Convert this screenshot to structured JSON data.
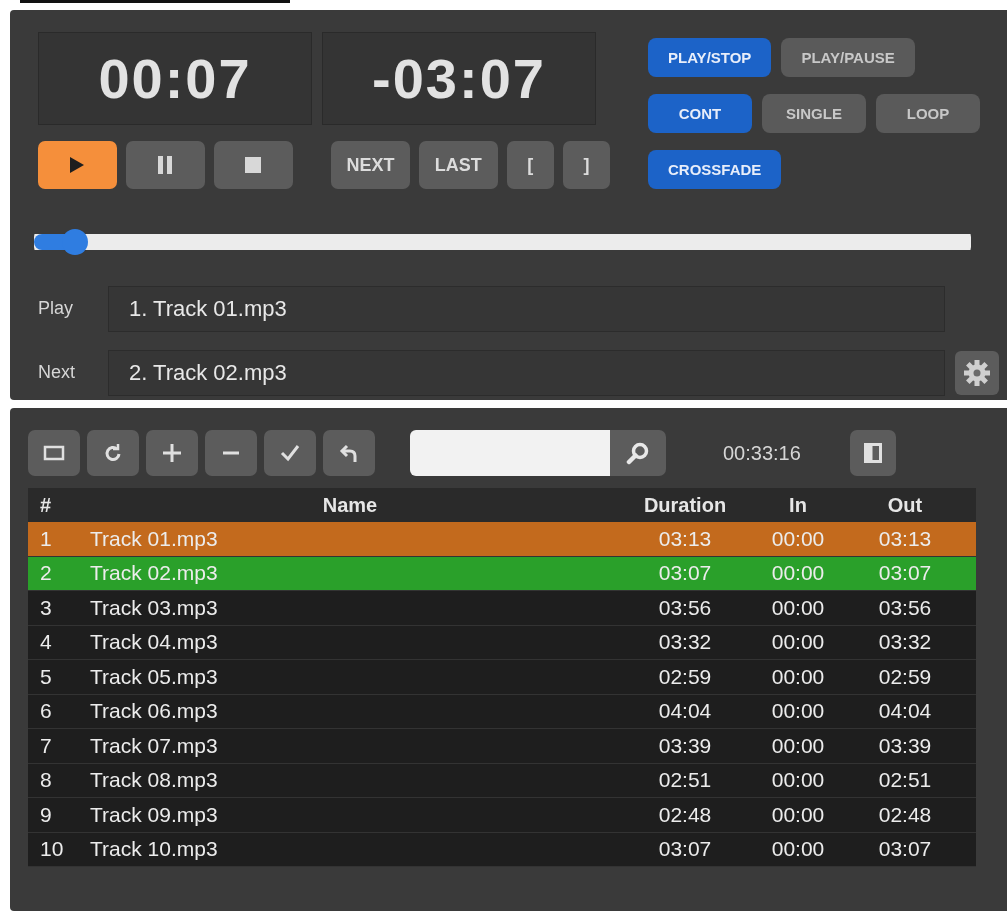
{
  "player": {
    "elapsed": "00:07",
    "remaining": "-03:07",
    "transport": [
      {
        "kind": "play",
        "selected": true
      },
      {
        "kind": "pause",
        "selected": false
      },
      {
        "kind": "stop",
        "selected": false
      }
    ],
    "nav_buttons": [
      "NEXT",
      "LAST",
      "[",
      "]"
    ],
    "mode_rows": [
      [
        {
          "label": "PLAY/STOP",
          "selected": true
        },
        {
          "label": "PLAY/PAUSE",
          "selected": false
        }
      ],
      [
        {
          "label": "CONT",
          "selected": true
        },
        {
          "label": "SINGLE",
          "selected": false
        },
        {
          "label": "LOOP",
          "selected": false
        }
      ],
      [
        {
          "label": "CROSSFADE",
          "selected": true
        }
      ]
    ],
    "position": {
      "level": 0.03
    },
    "play_label": "Play",
    "play_value": "1. Track 01.mp3",
    "next_label": "Next",
    "next_value": "2. Track 02.mp3"
  },
  "playlist": {
    "total_time": "00:33:16",
    "columns": [
      "#",
      "Name",
      "Duration",
      "In",
      "Out"
    ],
    "rows": [
      {
        "num": "1",
        "name": "Track 01.mp3",
        "duration": "03:13",
        "in": "00:00",
        "out": "03:13",
        "playing": true,
        "queued": false
      },
      {
        "num": "2",
        "name": "Track 02.mp3",
        "duration": "03:07",
        "in": "00:00",
        "out": "03:07",
        "playing": false,
        "queued": true
      },
      {
        "num": "3",
        "name": "Track 03.mp3",
        "duration": "03:56",
        "in": "00:00",
        "out": "03:56",
        "playing": false,
        "queued": false
      },
      {
        "num": "4",
        "name": "Track 04.mp3",
        "duration": "03:32",
        "in": "00:00",
        "out": "03:32",
        "playing": false,
        "queued": false
      },
      {
        "num": "5",
        "name": "Track 05.mp3",
        "duration": "02:59",
        "in": "00:00",
        "out": "02:59",
        "playing": false,
        "queued": false
      },
      {
        "num": "6",
        "name": "Track 06.mp3",
        "duration": "04:04",
        "in": "00:00",
        "out": "04:04",
        "playing": false,
        "queued": false
      },
      {
        "num": "7",
        "name": "Track 07.mp3",
        "duration": "03:39",
        "in": "00:00",
        "out": "03:39",
        "playing": false,
        "queued": false
      },
      {
        "num": "8",
        "name": "Track 08.mp3",
        "duration": "02:51",
        "in": "00:00",
        "out": "02:51",
        "playing": false,
        "queued": false
      },
      {
        "num": "9",
        "name": "Track 09.mp3",
        "duration": "02:48",
        "in": "00:00",
        "out": "02:48",
        "playing": false,
        "queued": false
      },
      {
        "num": "10",
        "name": "Track 10.mp3",
        "duration": "03:07",
        "in": "00:00",
        "out": "03:07",
        "playing": false,
        "queued": false
      }
    ]
  }
}
